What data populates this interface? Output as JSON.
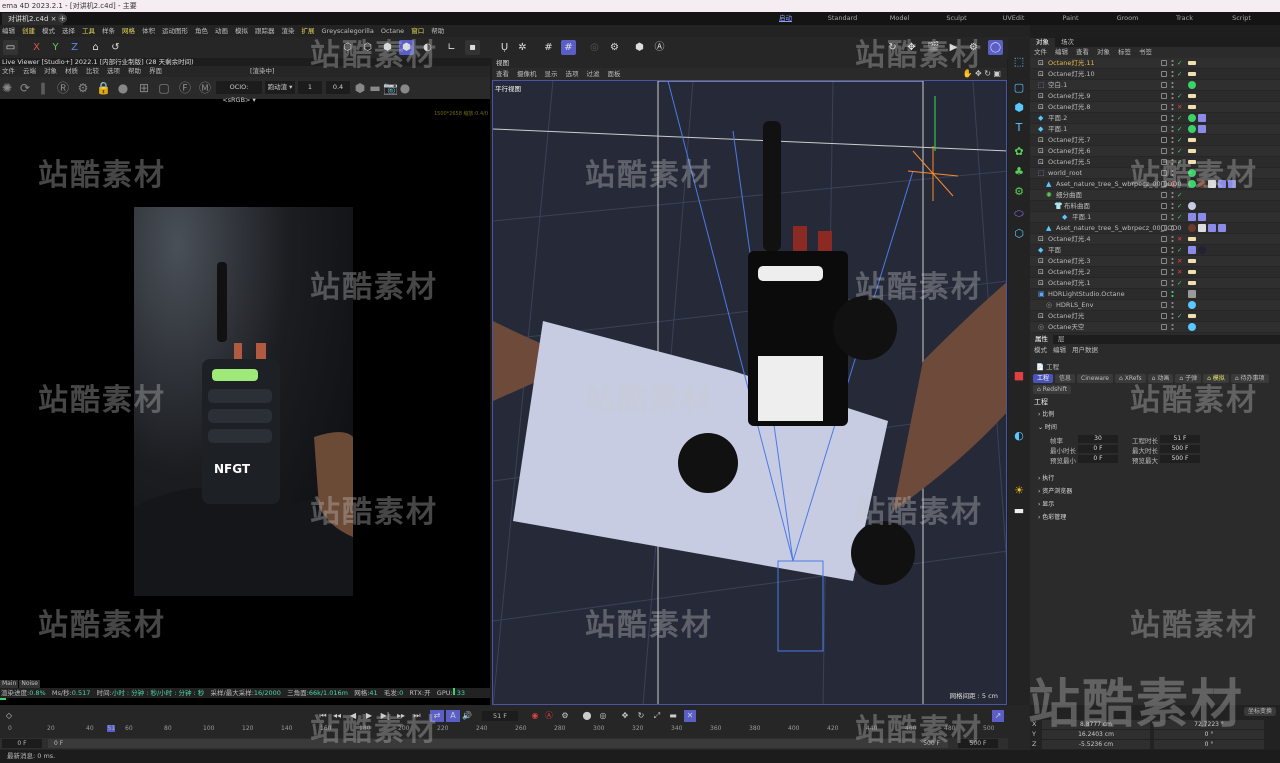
{
  "window_title": "ema 4D 2023.2.1 - [对讲机2.c4d] - 主要",
  "doc_tab": "对讲机2.c4d ×",
  "new_tab": "+",
  "layouts": [
    "启动",
    "Standard",
    "Model",
    "Sculpt",
    "UVEdit",
    "Paint",
    "Groom",
    "Track",
    "Script"
  ],
  "menu": [
    "编辑",
    "创建",
    "模式",
    "选择",
    "工具",
    "样条",
    "网格",
    "体积",
    "运动图形",
    "角色",
    "动画",
    "模拟",
    "跟踪器",
    "渲染",
    "扩展",
    "Greyscalegorilla",
    "Octane",
    "窗口",
    "帮助"
  ],
  "axis": {
    "x": "X",
    "y": "Y",
    "z": "Z"
  },
  "live_viewer": {
    "title": "Live Viewer [Studio+] 2022.1 [内部行业制版] (28 天剩余时间)",
    "menu": [
      "文件",
      "云端",
      "对象",
      "材质",
      "比较",
      "选项",
      "帮助",
      "界面"
    ],
    "state": "[渲染中]",
    "ocio": "OCIO:<sRGB> ▾",
    "preset": "跑动渲 ▾",
    "value1": "1",
    "value2": "0.4",
    "resolution": "1500*2658 缩放:0.4/0",
    "render_label": "NFGT",
    "tabs": [
      "Main",
      "Noise"
    ],
    "status": {
      "progress_label": "渲染进度:",
      "progress": "0.8%",
      "ms_label": "Ms/秒:",
      "ms": "0.517",
      "time_label": "时间:",
      "time": "小时 : 分钟 : 秒/小时 : 分钟 : 秒",
      "samples_label": "采样/最大采样:",
      "samples": "16/2000",
      "tri_label": "三角面:",
      "tri": "66k/1.016m",
      "mesh_label": "网格:",
      "mesh": "41",
      "hair_label": "毛发:",
      "hair": "0",
      "rtx": "RTX:开",
      "gpu_label": "GPU:",
      "gpu": "33"
    },
    "progress_fraction": 0.008
  },
  "viewport": {
    "header": "视图",
    "menu": [
      "查看",
      "摄像机",
      "显示",
      "选项",
      "过滤",
      "面板"
    ],
    "label": "平行视图",
    "grid": "网格间距 : 5 cm"
  },
  "object_manager": {
    "tabs": [
      "对象",
      "场次"
    ],
    "menu": [
      "文件",
      "编辑",
      "查看",
      "对象",
      "标签",
      "书签"
    ],
    "rows": [
      {
        "name": "Octane灯光.11",
        "indent": 0,
        "icon": "light",
        "status": "check",
        "tags": [
          "light"
        ],
        "selected": true
      },
      {
        "name": "Octane灯光.10",
        "indent": 0,
        "icon": "light",
        "status": "check",
        "tags": [
          "light"
        ]
      },
      {
        "name": "空白.1",
        "indent": 0,
        "icon": "null",
        "status": "",
        "tags": [
          "green"
        ]
      },
      {
        "name": "Octane灯光.9",
        "indent": 0,
        "icon": "light",
        "status": "check",
        "tags": [
          "light"
        ]
      },
      {
        "name": "Octane灯光.8",
        "indent": 0,
        "icon": "light",
        "status": "x",
        "tags": [
          "light"
        ]
      },
      {
        "name": "平面.2",
        "indent": 0,
        "icon": "plane",
        "status": "check",
        "tags": [
          "green",
          "uv"
        ]
      },
      {
        "name": "平面.1",
        "indent": 0,
        "icon": "plane",
        "status": "check",
        "tags": [
          "green",
          "uv"
        ]
      },
      {
        "name": "Octane灯光.7",
        "indent": 0,
        "icon": "light",
        "status": "check",
        "tags": [
          "light"
        ]
      },
      {
        "name": "Octane灯光.6",
        "indent": 0,
        "icon": "light",
        "status": "check",
        "tags": [
          "light"
        ]
      },
      {
        "name": "Octane灯光.5",
        "indent": 0,
        "icon": "light",
        "status": "check",
        "tags": [
          "light"
        ]
      },
      {
        "name": "world_root",
        "indent": 0,
        "icon": "null",
        "status": "",
        "tags": [
          "green"
        ]
      },
      {
        "name": "Aset_nature_tree_S_wbrpecz_00_LOD0",
        "indent": 1,
        "icon": "poly",
        "status": "",
        "tags": [
          "green",
          "mat",
          "checker",
          "uv",
          "tri"
        ],
        "red": true
      },
      {
        "name": "细分曲面",
        "indent": 1,
        "icon": "subd",
        "status": "check",
        "tags": []
      },
      {
        "name": "布料曲面",
        "indent": 2,
        "icon": "cloth",
        "status": "check",
        "tags": [
          "sphere"
        ]
      },
      {
        "name": "平面.1",
        "indent": 3,
        "icon": "plane",
        "status": "check",
        "tags": [
          "shirt",
          "uv"
        ]
      },
      {
        "name": "Aset_nature_tree_S_wbrpecz_00_LOD0",
        "indent": 1,
        "icon": "poly",
        "status": "",
        "tags": [
          "mat",
          "checker",
          "uv",
          "tri"
        ]
      },
      {
        "name": "Octane灯光.4",
        "indent": 0,
        "icon": "light",
        "status": "x",
        "tags": [
          "light"
        ]
      },
      {
        "name": "平面",
        "indent": 0,
        "icon": "plane",
        "status": "check",
        "tags": [
          "uv",
          "dark"
        ]
      },
      {
        "name": "Octane灯光.3",
        "indent": 0,
        "icon": "light",
        "status": "x",
        "tags": [
          "light"
        ]
      },
      {
        "name": "Octane灯光.2",
        "indent": 0,
        "icon": "light",
        "status": "x",
        "tags": [
          "light"
        ]
      },
      {
        "name": "Octane灯光.1",
        "indent": 0,
        "icon": "light",
        "status": "check",
        "tags": [
          "light"
        ]
      },
      {
        "name": "HDRLightStudio.Octane",
        "indent": 0,
        "icon": "hdr",
        "status": "",
        "tags": [
          "ban"
        ],
        "green": true
      },
      {
        "name": "HDRLS_Env",
        "indent": 1,
        "icon": "env",
        "status": "",
        "tags": [
          "half"
        ]
      },
      {
        "name": "Octane灯光",
        "indent": 0,
        "icon": "light",
        "status": "check",
        "tags": [
          "light"
        ]
      },
      {
        "name": "Octane天空",
        "indent": 0,
        "icon": "env",
        "status": "",
        "tags": [
          "half"
        ]
      }
    ]
  },
  "attributes": {
    "tabs": [
      "属性",
      "层"
    ],
    "menu": [
      "模式",
      "编辑",
      "用户数据"
    ],
    "object": "工程",
    "chips": [
      {
        "label": "工程",
        "active": true
      },
      {
        "label": "信息"
      },
      {
        "label": "Cineware"
      },
      {
        "label": "⌂ XRefs"
      },
      {
        "label": "⌂ 动画"
      },
      {
        "label": "⌂ 子弹"
      },
      {
        "label": "⌂ 模拟",
        "hl": true
      },
      {
        "label": "⌂ 待办事项"
      },
      {
        "label": "⌂ Redshift"
      }
    ],
    "heading": "工程",
    "sections": [
      "› 比例",
      "⌄ 时间",
      "› 执行",
      "› 资产浏览器",
      "› 显示",
      "› 色彩管理"
    ],
    "time": {
      "fps_label": "帧率",
      "fps": "30",
      "proj_len_label": "工程时长",
      "proj_len": "51 F",
      "min_label": "最小时长",
      "min": "0 F",
      "max_label": "最大时长",
      "max": "500 F",
      "pmin_label": "预览最小",
      "pmin": "0 F",
      "pmax_label": "预览最大",
      "pmax": "500 F"
    }
  },
  "timeline": {
    "current_frame": "51 F",
    "marker": "51",
    "ticks": [
      "0",
      "20",
      "40",
      "60",
      "80",
      "100",
      "120",
      "140",
      "160",
      "180",
      "200",
      "220",
      "240",
      "260",
      "280",
      "300",
      "320",
      "340",
      "360",
      "380",
      "400",
      "420",
      "440",
      "460",
      "480",
      "500"
    ],
    "start": "0 F",
    "start2": "0 F",
    "end": "500 F",
    "end2": "500 F"
  },
  "coordinates": {
    "button": "坐标变换",
    "rows": [
      {
        "axis": "X",
        "pos": "8.8777 cm",
        "rot": "72.7223 °"
      },
      {
        "axis": "Y",
        "pos": "16.2403 cm",
        "rot": "0 °"
      },
      {
        "axis": "Z",
        "pos": "-5.5236 cm",
        "rot": "0 °"
      }
    ]
  },
  "status_line": "最新消息: 0 ms.",
  "watermark": "站酷素材",
  "colors": {
    "accent": "#5a5fc8",
    "highlight": "#e6d85a",
    "ok": "#3ad36a",
    "error": "#e04040"
  }
}
